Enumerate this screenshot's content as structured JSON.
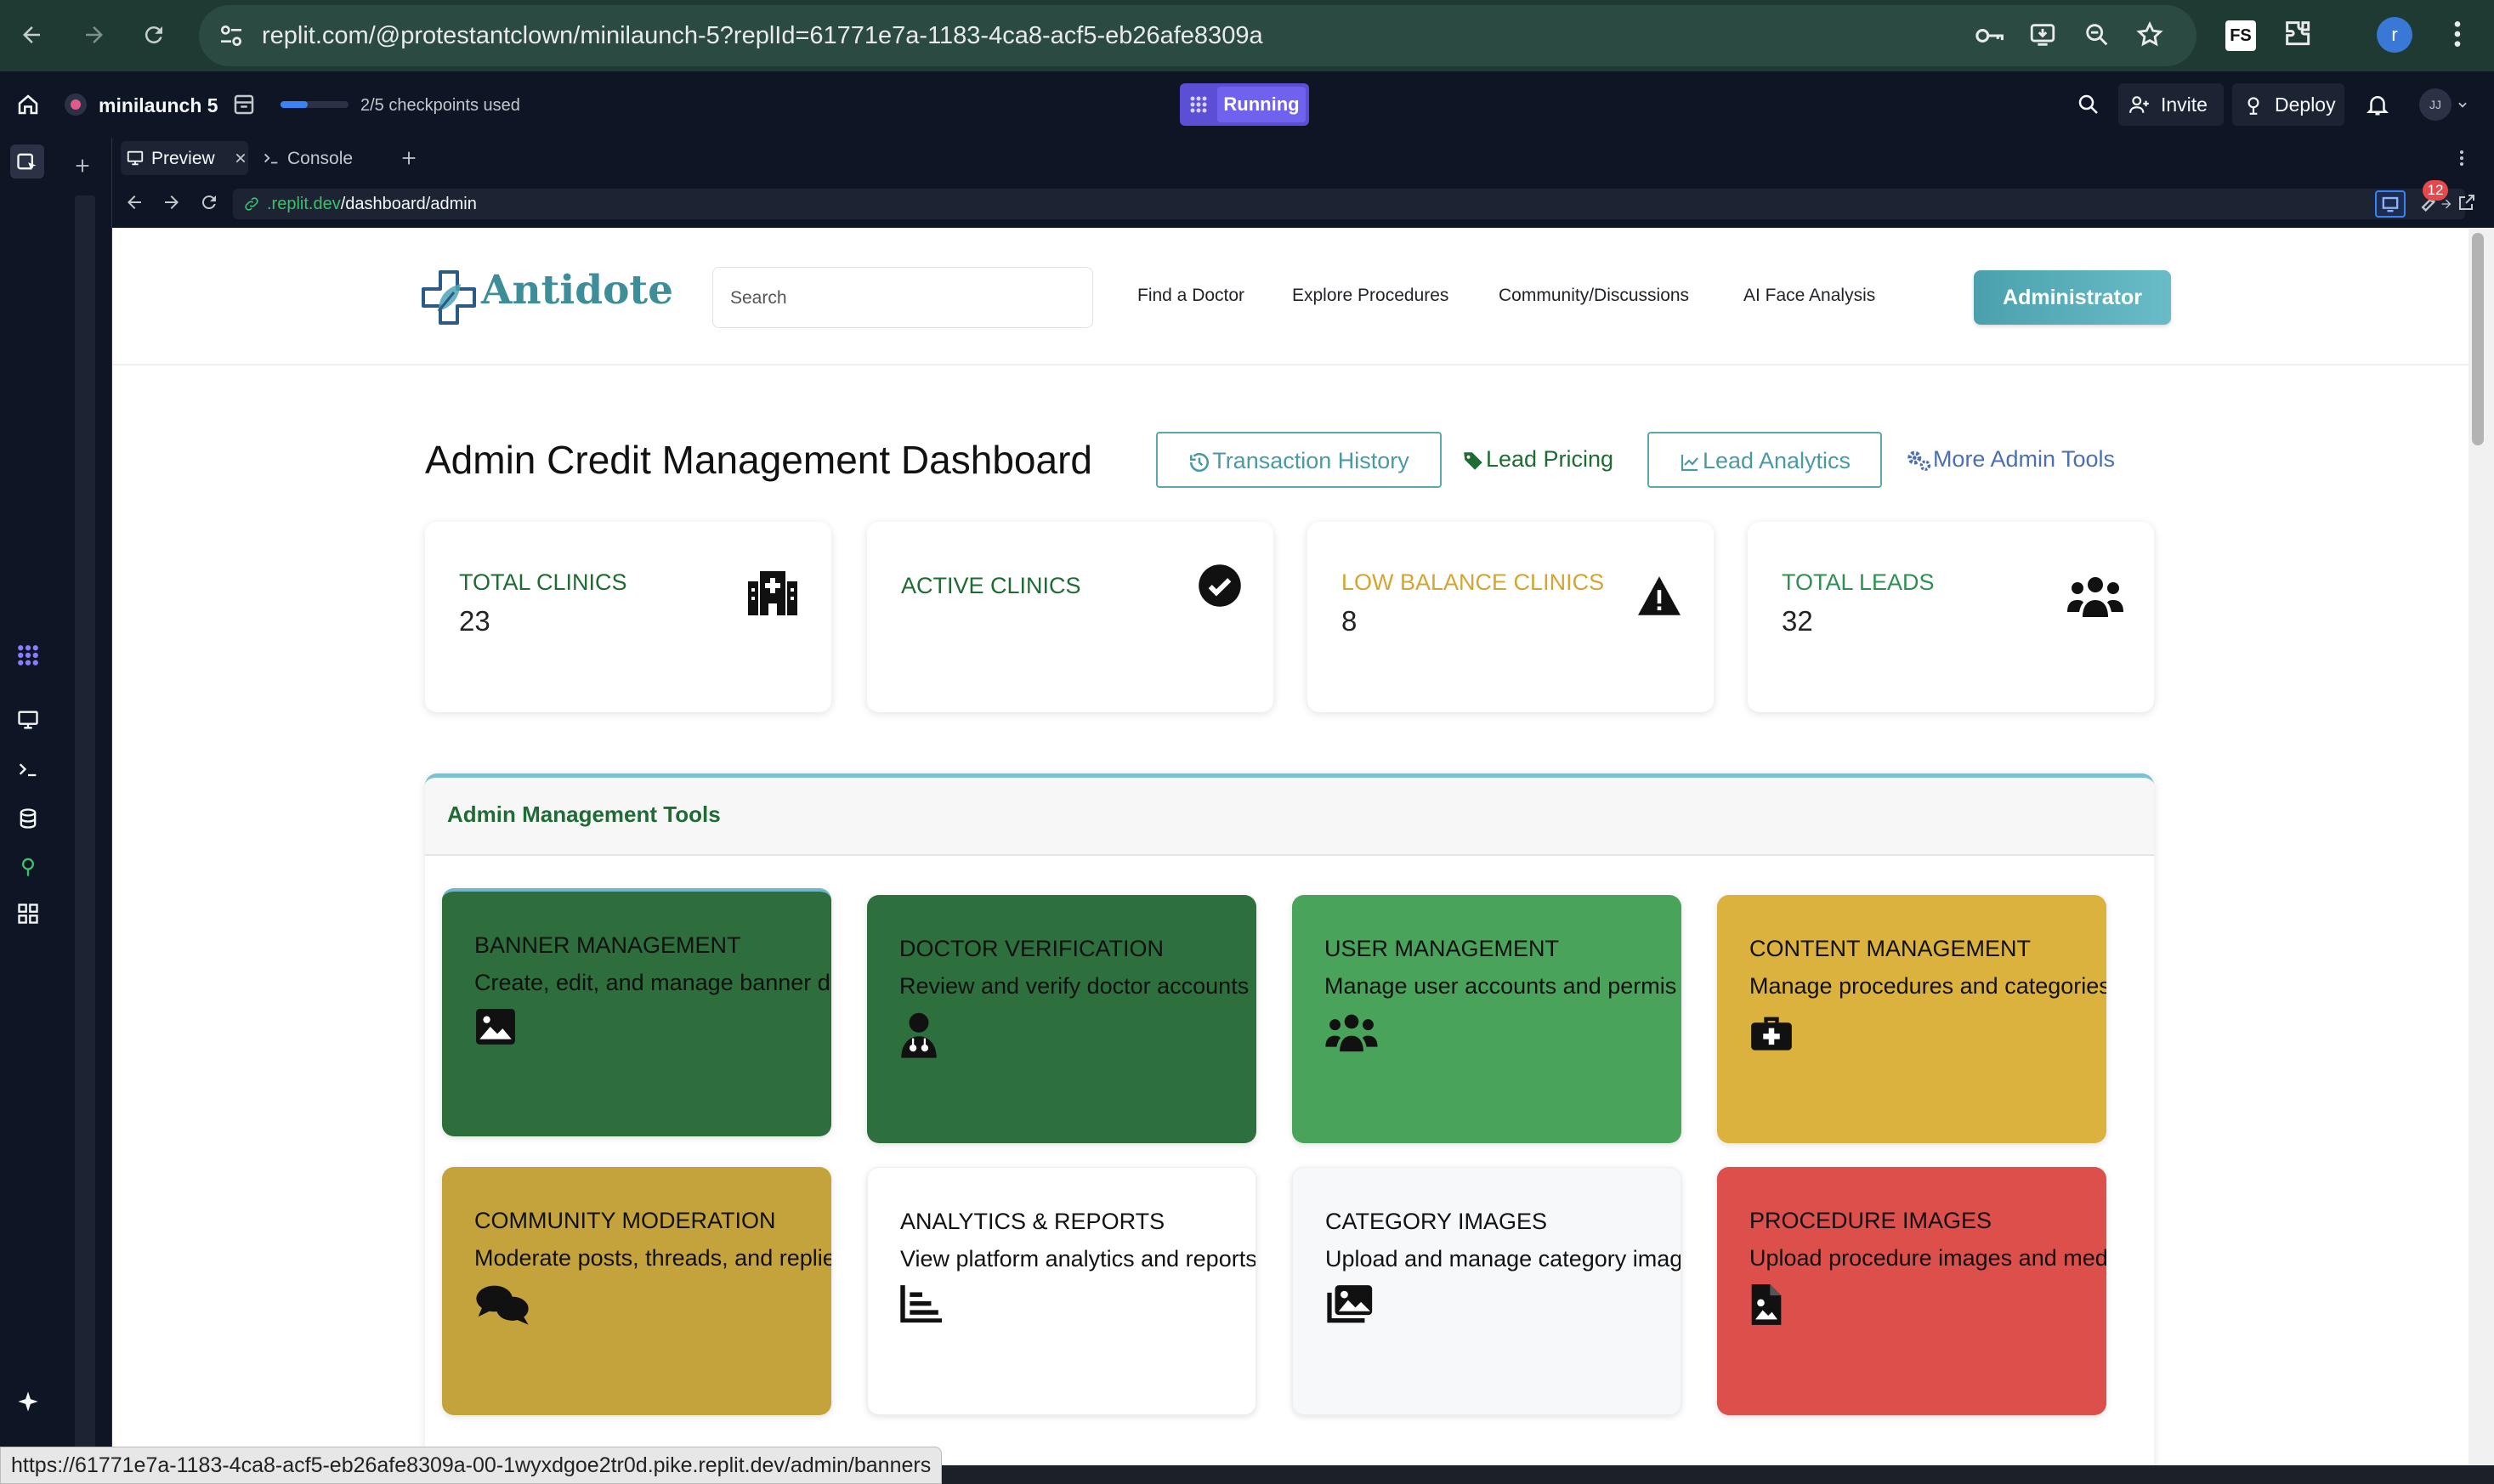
{
  "browser": {
    "url": "replit.com/@protestantclown/minilaunch-5?replId=61771e7a-1183-4ca8-acf5-eb26afe8309a",
    "profile_initial": "r"
  },
  "replit": {
    "project": "minilaunch 5",
    "checkpoints": "2/5 checkpoints used",
    "checkpoint_progress": 0.4,
    "status": "Running",
    "invite": "Invite",
    "deploy": "Deploy",
    "avatar": "JJ",
    "tabs": [
      "Preview",
      "Console"
    ],
    "addr_host": ".replit.dev",
    "addr_path": "/dashboard/admin",
    "badge_count": "12"
  },
  "site": {
    "logo": "Antidote",
    "search_placeholder": "Search",
    "nav": [
      "Find a Doctor",
      "Explore Procedures",
      "Community/Discussions",
      "AI Face Analysis"
    ],
    "admin_button": "Administrator",
    "title": "Admin Credit Management Dashboard",
    "buttons": {
      "history": "Transaction History",
      "pricing": "Lead Pricing",
      "analytics": "Lead Analytics",
      "more": "More Admin Tools"
    },
    "stats": [
      {
        "label": "TOTAL CLINICS",
        "value": "23",
        "color": "#1e6b34"
      },
      {
        "label": "ACTIVE CLINICS",
        "value": "",
        "color": "#1e6b34"
      },
      {
        "label": "LOW BALANCE CLINICS",
        "value": "8",
        "color": "#d4a531"
      },
      {
        "label": "TOTAL LEADS",
        "value": "32",
        "color": "#2e9151"
      }
    ],
    "tools_title": "Admin Management Tools",
    "cards": [
      {
        "title": "BANNER MANAGEMENT",
        "desc": "Create, edit, and manage banner d",
        "bg": "#2d6e3c",
        "fg": "#111"
      },
      {
        "title": "DOCTOR VERIFICATION",
        "desc": "Review and verify doctor accounts",
        "bg": "#2e6f3e",
        "fg": "#111"
      },
      {
        "title": "USER MANAGEMENT",
        "desc": "Manage user accounts and permis",
        "bg": "#4aa35a",
        "fg": "#111"
      },
      {
        "title": "CONTENT MANAGEMENT",
        "desc": "Manage procedures and categories",
        "bg": "#dbb23e",
        "fg": "#111"
      },
      {
        "title": "COMMUNITY MODERATION",
        "desc": "Moderate posts, threads, and replie",
        "bg": "#c4a23c",
        "fg": "#111"
      },
      {
        "title": "ANALYTICS & REPORTS",
        "desc": "View platform analytics and reports",
        "bg": "#ffffff",
        "fg": "#111"
      },
      {
        "title": "CATEGORY IMAGES",
        "desc": "Upload and manage category imag",
        "bg": "#f7f8fa",
        "fg": "#111"
      },
      {
        "title": "PROCEDURE IMAGES",
        "desc": "Upload procedure images and med",
        "bg": "#dd4f4b",
        "fg": "#111"
      }
    ]
  },
  "statusbar": "https://61771e7a-1183-4ca8-acf5-eb26afe8309a-00-1wyxdgoe2tr0d.pike.replit.dev/admin/banners"
}
